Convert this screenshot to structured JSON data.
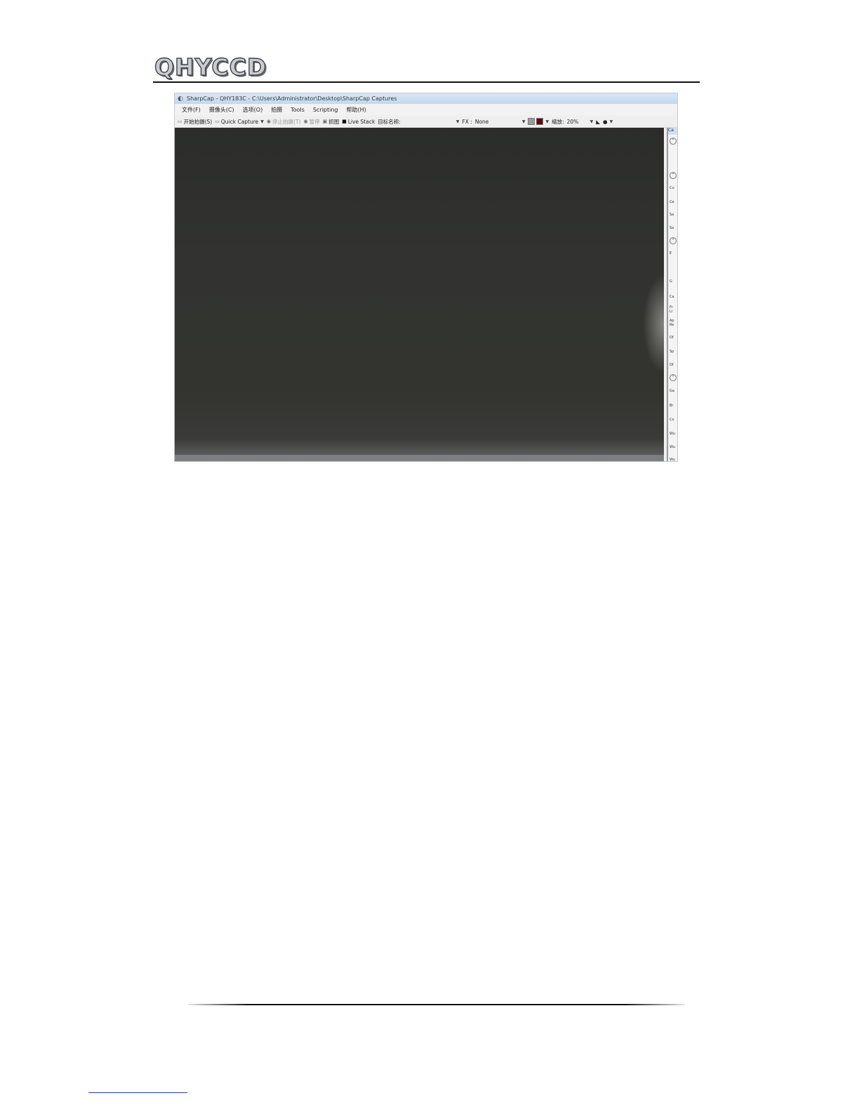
{
  "header": {
    "logo_text": "QHYCCD"
  },
  "app": {
    "title": "SharpCap - QHY183C - C:\\Users\\Administrator\\Desktop\\SharpCap Captures",
    "menu": [
      "文件(F)",
      "摄像头(C)",
      "选项(O)",
      "拍摄",
      "Tools",
      "Scripting",
      "帮助(H)"
    ],
    "toolbar": {
      "start_capture": "开始拍摄(S)",
      "quick_capture": "Quick Capture",
      "stop_capture": "停止拍摄(T)",
      "pause": "暂停",
      "snapshot": "抓图",
      "live_stack": "Live Stack",
      "target_name_label": "目标名称:",
      "fx_label": "FX :",
      "fx_value": "None",
      "zoom_label": "缩放:",
      "zoom_value": "20%"
    },
    "right_panel_fragments": [
      "Ca",
      "Cu",
      "Ca",
      "Sa",
      "Sa",
      "E",
      "G",
      "Ca",
      "Fr",
      "Li",
      "Ap",
      "Re",
      "Of",
      "Sp",
      "Of",
      "Ga",
      "Br",
      "Co",
      "Wu",
      "Wu",
      "Wu"
    ],
    "colors": {
      "viewport": "#2f302d",
      "swatch_gray": "#9a9a9a",
      "swatch_red": "#5a0b0b"
    }
  }
}
